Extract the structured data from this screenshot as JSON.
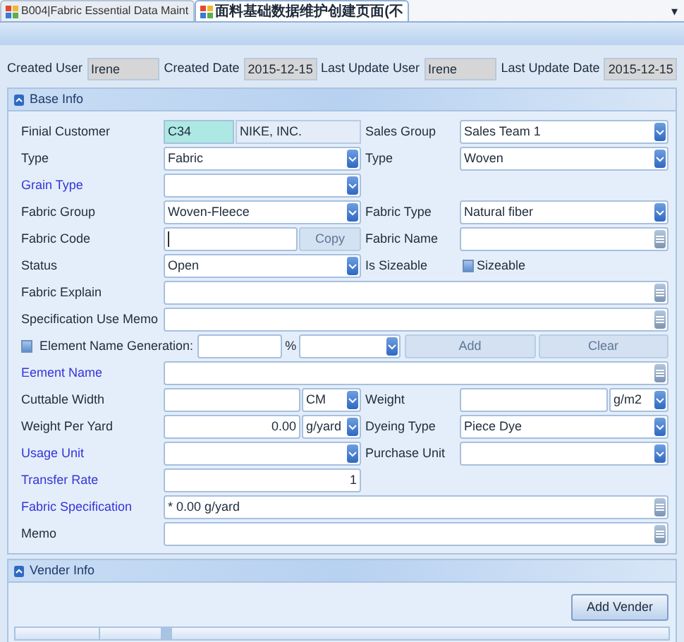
{
  "tabs": [
    {
      "label": "B004|Fabric Essential Data Maint",
      "selected": false
    },
    {
      "label": "面料基础数据维护创建页面(不",
      "selected": true
    }
  ],
  "tab_menu": "▾",
  "audit": [
    {
      "label": "Created User",
      "value": "Irene"
    },
    {
      "label": "Created Date",
      "value": "2015-12-15"
    },
    {
      "label": "Last Update User",
      "value": "Irene"
    },
    {
      "label": "Last Update Date",
      "value": "2015-12-15"
    }
  ],
  "base_info": {
    "title": "Base Info",
    "expanded": true,
    "rows": [
      {
        "kind": "pair",
        "left": {
          "label": "Finial Customer",
          "link": false,
          "field": {
            "kind": "customer",
            "code": "C34",
            "name": "NIKE, INC."
          }
        },
        "right": {
          "label": "Sales Group",
          "link": false,
          "field": {
            "kind": "combo",
            "value": "Sales Team 1"
          }
        }
      },
      {
        "kind": "pair",
        "left": {
          "label": "Type",
          "link": false,
          "field": {
            "kind": "combo",
            "value": "Fabric"
          }
        },
        "right": {
          "label": "Type",
          "link": false,
          "field": {
            "kind": "combo",
            "value": "Woven"
          }
        }
      },
      {
        "kind": "pair",
        "left": {
          "label": "Grain Type",
          "link": true,
          "field": {
            "kind": "combo"
          }
        }
      },
      {
        "kind": "pair",
        "left": {
          "label": "Fabric Group",
          "link": false,
          "field": {
            "kind": "combo",
            "value": "Woven-Fleece"
          }
        },
        "right": {
          "label": "Fabric Type",
          "link": false,
          "field": {
            "kind": "combo",
            "value": "Natural fiber"
          }
        }
      },
      {
        "kind": "pair",
        "left": {
          "label": "Fabric Code",
          "link": false,
          "field": {
            "kind": "text_button",
            "button": "Copy",
            "disabled": true
          }
        },
        "right": {
          "label": "Fabric Name",
          "link": false,
          "field": {
            "kind": "memo"
          }
        }
      },
      {
        "kind": "pair",
        "left": {
          "label": "Status",
          "link": false,
          "field": {
            "kind": "combo",
            "value": "Open"
          }
        },
        "right": {
          "label": "Is Sizeable",
          "link": false,
          "field": {
            "kind": "checkbox",
            "label": "Sizeable",
            "checked": false
          }
        }
      },
      {
        "kind": "wide",
        "label": "Fabric Explain",
        "link": false,
        "field": {
          "kind": "memo"
        }
      },
      {
        "kind": "wide",
        "label": "Specification Use Memo",
        "link": false,
        "field": {
          "kind": "memo"
        }
      },
      {
        "kind": "generation",
        "checked": false,
        "label": "Element Name Generation:",
        "percent": "%",
        "add": {
          "label": "Add",
          "disabled": true
        },
        "clear": {
          "label": "Clear",
          "disabled": true
        }
      },
      {
        "kind": "wide",
        "label": "Eement Name",
        "link": true,
        "field": {
          "kind": "memo"
        }
      },
      {
        "kind": "pair",
        "left": {
          "label": "Cuttable Width",
          "link": false,
          "field": {
            "kind": "measure",
            "unit": "CM"
          }
        },
        "right": {
          "label": "Weight",
          "link": false,
          "field": {
            "kind": "measure",
            "unit": "g/m2"
          }
        }
      },
      {
        "kind": "pair",
        "left": {
          "label": "Weight Per Yard",
          "link": false,
          "field": {
            "kind": "measure",
            "value": "0.00",
            "unit": "g/yard"
          }
        },
        "right": {
          "label": "Dyeing Type",
          "link": false,
          "field": {
            "kind": "combo",
            "value": "Piece Dye"
          }
        }
      },
      {
        "kind": "pair",
        "left": {
          "label": "Usage Unit",
          "link": true,
          "field": {
            "kind": "combo"
          }
        },
        "right": {
          "label": "Purchase Unit",
          "link": false,
          "field": {
            "kind": "combo"
          }
        }
      },
      {
        "kind": "pair",
        "left": {
          "label": "Transfer Rate",
          "link": true,
          "field": {
            "kind": "number",
            "value": "1"
          }
        }
      },
      {
        "kind": "wide",
        "label": "Fabric Specification",
        "link": true,
        "field": {
          "kind": "memo",
          "value": "* 0.00 g/yard"
        }
      },
      {
        "kind": "wide",
        "label": "Memo",
        "link": false,
        "field": {
          "kind": "memo"
        }
      }
    ]
  },
  "vender_info": {
    "title": "Vender Info",
    "expanded": true,
    "button": "Add Vender"
  }
}
